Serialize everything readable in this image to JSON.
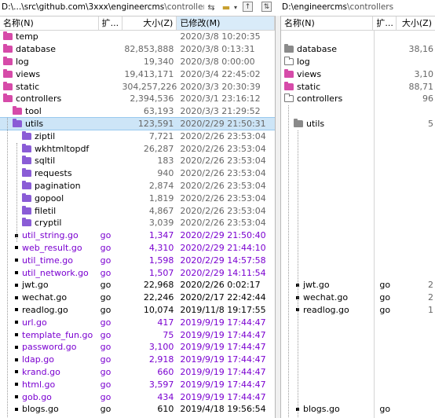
{
  "left_path": {
    "prefix": "D:\\...\\src\\github.com\\3xxx\\engineercms",
    "suffix": "\\controllers"
  },
  "right_path": {
    "prefix": "D:\\engineercms",
    "suffix": "\\controllers"
  },
  "headers": {
    "name": "名称(N)",
    "ext": "扩...",
    "size": "大小(Z)",
    "date": "已修改(M)"
  },
  "right_headers": {
    "name": "名称(N)",
    "ext": "扩...",
    "size": "大小(Z)"
  },
  "left_rows": [
    {
      "name": "temp",
      "ext": "",
      "size": "",
      "date": "2020/3/8 10:20:35"
    },
    {
      "name": "database",
      "ext": "",
      "size": "82,853,888",
      "date": "2020/3/8 0:13:31"
    },
    {
      "name": "log",
      "ext": "",
      "size": "19,340",
      "date": "2020/3/8 0:00:00"
    },
    {
      "name": "views",
      "ext": "",
      "size": "19,413,171",
      "date": "2020/3/4 22:45:02"
    },
    {
      "name": "static",
      "ext": "",
      "size": "304,257,226",
      "date": "2020/3/3 20:30:39"
    },
    {
      "name": "controllers",
      "ext": "",
      "size": "2,394,536",
      "date": "2020/3/1 23:16:12"
    },
    {
      "name": "tool",
      "ext": "",
      "size": "63,193",
      "date": "2020/3/3 21:29:52"
    },
    {
      "name": "utils",
      "ext": "",
      "size": "123,591",
      "date": "2020/2/29 21:50:31"
    },
    {
      "name": "ziptil",
      "ext": "",
      "size": "7,721",
      "date": "2020/2/26 23:53:04"
    },
    {
      "name": "wkhtmltopdf",
      "ext": "",
      "size": "26,287",
      "date": "2020/2/26 23:53:04"
    },
    {
      "name": "sqltil",
      "ext": "",
      "size": "183",
      "date": "2020/2/26 23:53:04"
    },
    {
      "name": "requests",
      "ext": "",
      "size": "940",
      "date": "2020/2/26 23:53:04"
    },
    {
      "name": "pagination",
      "ext": "",
      "size": "2,874",
      "date": "2020/2/26 23:53:04"
    },
    {
      "name": "gopool",
      "ext": "",
      "size": "1,819",
      "date": "2020/2/26 23:53:04"
    },
    {
      "name": "filetil",
      "ext": "",
      "size": "4,867",
      "date": "2020/2/26 23:53:04"
    },
    {
      "name": "cryptil",
      "ext": "",
      "size": "3,039",
      "date": "2020/2/26 23:53:04"
    },
    {
      "name": "util_string.go",
      "ext": "go",
      "size": "1,347",
      "date": "2020/2/29 21:50:40"
    },
    {
      "name": "web_result.go",
      "ext": "go",
      "size": "4,310",
      "date": "2020/2/29 21:44:10"
    },
    {
      "name": "util_time.go",
      "ext": "go",
      "size": "1,598",
      "date": "2020/2/29 14:57:58"
    },
    {
      "name": "util_network.go",
      "ext": "go",
      "size": "1,507",
      "date": "2020/2/29 14:11:54"
    },
    {
      "name": "jwt.go",
      "ext": "go",
      "size": "22,968",
      "date": "2020/2/26 0:02:17"
    },
    {
      "name": "wechat.go",
      "ext": "go",
      "size": "22,246",
      "date": "2020/2/17 22:42:44"
    },
    {
      "name": "readlog.go",
      "ext": "go",
      "size": "10,074",
      "date": "2019/11/8 19:17:55"
    },
    {
      "name": "url.go",
      "ext": "go",
      "size": "417",
      "date": "2019/9/19 17:44:47"
    },
    {
      "name": "template_fun.go",
      "ext": "go",
      "size": "75",
      "date": "2019/9/19 17:44:47"
    },
    {
      "name": "password.go",
      "ext": "go",
      "size": "3,100",
      "date": "2019/9/19 17:44:47"
    },
    {
      "name": "ldap.go",
      "ext": "go",
      "size": "2,918",
      "date": "2019/9/19 17:44:47"
    },
    {
      "name": "krand.go",
      "ext": "go",
      "size": "660",
      "date": "2019/9/19 17:44:47"
    },
    {
      "name": "html.go",
      "ext": "go",
      "size": "3,597",
      "date": "2019/9/19 17:44:47"
    },
    {
      "name": "gob.go",
      "ext": "go",
      "size": "434",
      "date": "2019/9/19 17:44:47"
    },
    {
      "name": "blogs.go",
      "ext": "go",
      "size": "610",
      "date": "2019/4/18 19:56:54"
    }
  ],
  "right_rows": [
    {
      "name": "",
      "ext": "",
      "size": ""
    },
    {
      "name": "database",
      "ext": "",
      "size": "38,16"
    },
    {
      "name": "log",
      "ext": "",
      "size": ""
    },
    {
      "name": "views",
      "ext": "",
      "size": "3,10"
    },
    {
      "name": "static",
      "ext": "",
      "size": "88,71"
    },
    {
      "name": "controllers",
      "ext": "",
      "size": "96"
    },
    {
      "name": "",
      "ext": "",
      "size": ""
    },
    {
      "name": "utils",
      "ext": "",
      "size": "5"
    },
    {
      "name": "",
      "ext": "",
      "size": ""
    },
    {
      "name": "",
      "ext": "",
      "size": ""
    },
    {
      "name": "",
      "ext": "",
      "size": ""
    },
    {
      "name": "",
      "ext": "",
      "size": ""
    },
    {
      "name": "",
      "ext": "",
      "size": ""
    },
    {
      "name": "",
      "ext": "",
      "size": ""
    },
    {
      "name": "",
      "ext": "",
      "size": ""
    },
    {
      "name": "",
      "ext": "",
      "size": ""
    },
    {
      "name": "",
      "ext": "",
      "size": ""
    },
    {
      "name": "",
      "ext": "",
      "size": ""
    },
    {
      "name": "",
      "ext": "",
      "size": ""
    },
    {
      "name": "",
      "ext": "",
      "size": ""
    },
    {
      "name": "jwt.go",
      "ext": "go",
      "size": "2"
    },
    {
      "name": "wechat.go",
      "ext": "go",
      "size": "2"
    },
    {
      "name": "readlog.go",
      "ext": "go",
      "size": "1"
    },
    {
      "name": "",
      "ext": "",
      "size": ""
    },
    {
      "name": "",
      "ext": "",
      "size": ""
    },
    {
      "name": "",
      "ext": "",
      "size": ""
    },
    {
      "name": "",
      "ext": "",
      "size": ""
    },
    {
      "name": "",
      "ext": "",
      "size": ""
    },
    {
      "name": "",
      "ext": "",
      "size": ""
    },
    {
      "name": "",
      "ext": "",
      "size": ""
    },
    {
      "name": "blogs.go",
      "ext": "go",
      "size": ""
    }
  ]
}
